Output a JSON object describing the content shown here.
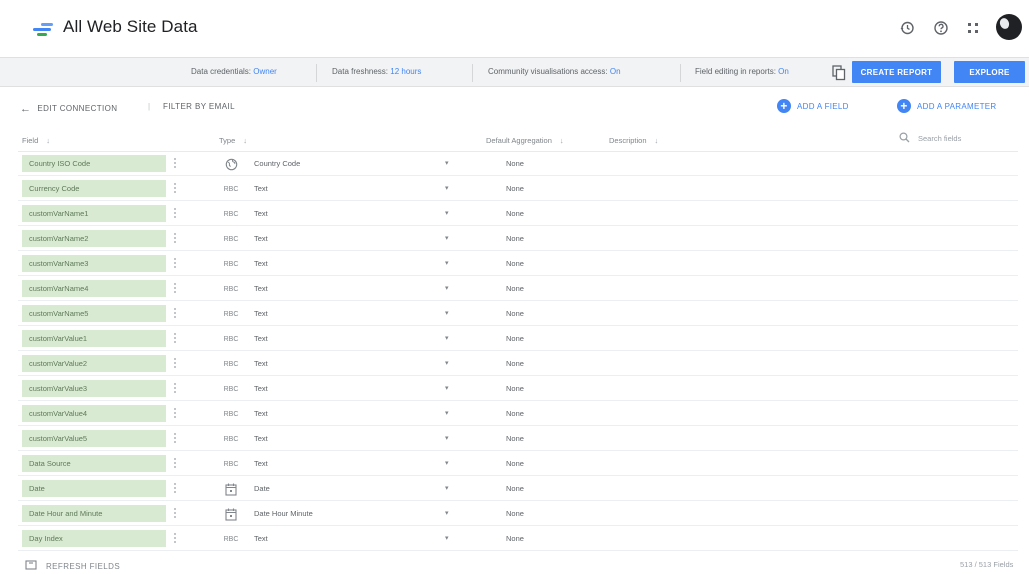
{
  "header": {
    "title": "All Web Site Data",
    "icons": [
      "history-icon",
      "help-icon",
      "apps-icon",
      "avatar"
    ]
  },
  "strip": {
    "credentials_label": "Data credentials:",
    "credentials_value": "Owner",
    "freshness_label": "Data freshness:",
    "freshness_value": "12 hours",
    "community_label": "Community visualisations access:",
    "community_value": "On",
    "field_editing_label": "Field editing in reports:",
    "field_editing_value": "On",
    "create_report": "CREATE REPORT",
    "explore": "EXPLORE"
  },
  "toolbar": {
    "edit_connection": "EDIT CONNECTION",
    "filter_by_email": "FILTER BY EMAIL",
    "add_field": "ADD A FIELD",
    "add_parameter": "ADD A PARAMETER"
  },
  "columns": {
    "field": "Field",
    "type": "Type",
    "default_aggregation": "Default Aggregation",
    "description": "Description",
    "search_placeholder": "Search fields"
  },
  "rows": [
    {
      "field": "Country ISO Code",
      "type_icon": "globe-icon",
      "type": "Country Code",
      "agg": "None"
    },
    {
      "field": "Currency Code",
      "type_icon": "text-icon",
      "type": "Text",
      "agg": "None"
    },
    {
      "field": "customVarName1",
      "type_icon": "text-icon",
      "type": "Text",
      "agg": "None"
    },
    {
      "field": "customVarName2",
      "type_icon": "text-icon",
      "type": "Text",
      "agg": "None"
    },
    {
      "field": "customVarName3",
      "type_icon": "text-icon",
      "type": "Text",
      "agg": "None"
    },
    {
      "field": "customVarName4",
      "type_icon": "text-icon",
      "type": "Text",
      "agg": "None"
    },
    {
      "field": "customVarName5",
      "type_icon": "text-icon",
      "type": "Text",
      "agg": "None"
    },
    {
      "field": "customVarValue1",
      "type_icon": "text-icon",
      "type": "Text",
      "agg": "None"
    },
    {
      "field": "customVarValue2",
      "type_icon": "text-icon",
      "type": "Text",
      "agg": "None"
    },
    {
      "field": "customVarValue3",
      "type_icon": "text-icon",
      "type": "Text",
      "agg": "None"
    },
    {
      "field": "customVarValue4",
      "type_icon": "text-icon",
      "type": "Text",
      "agg": "None"
    },
    {
      "field": "customVarValue5",
      "type_icon": "text-icon",
      "type": "Text",
      "agg": "None"
    },
    {
      "field": "Data Source",
      "type_icon": "text-icon",
      "type": "Text",
      "agg": "None"
    },
    {
      "field": "Date",
      "type_icon": "calendar-icon",
      "type": "Date",
      "agg": "None"
    },
    {
      "field": "Date Hour and Minute",
      "type_icon": "calendar-icon",
      "type": "Date Hour Minute",
      "agg": "None"
    },
    {
      "field": "Day Index",
      "type_icon": "text-icon",
      "type": "Text",
      "agg": "None"
    }
  ],
  "type_icon_text": "RBC",
  "footer": {
    "refresh": "REFRESH FIELDS",
    "count": "513 / 513 Fields"
  },
  "colors": {
    "accent": "#4285f4",
    "chip_bg": "#d9ead3",
    "chip_text": "#5f7a59",
    "strip_bg": "#f1f3f4"
  }
}
